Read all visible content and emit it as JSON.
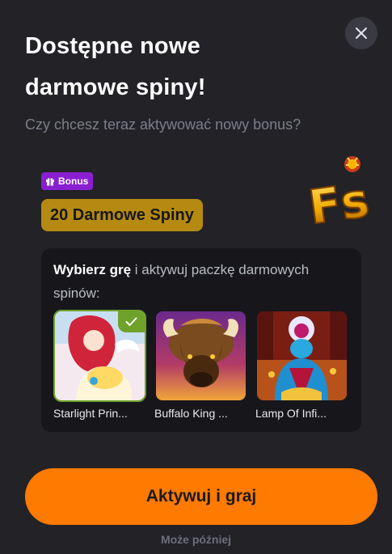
{
  "modal": {
    "title": "Dostępne nowe darmowe spiny!",
    "subtitle": "Czy chcesz teraz aktywować nowy bonus?",
    "close_icon": "close-icon"
  },
  "bonus": {
    "badge_label": "Bonus",
    "badge_icon": "gift-icon",
    "offer_label": "20 Darmowe Spiny",
    "logo_text": "Fs",
    "colors": {
      "badge": "#8a1fd1",
      "offer": "#b58a10"
    }
  },
  "game_picker": {
    "prompt_bold": "Wybierz grę",
    "prompt_rest": " i aktywuj paczkę darmowych spinów:",
    "games": [
      {
        "name": "Starlight Prin...",
        "selected": true
      },
      {
        "name": "Buffalo King ...",
        "selected": false
      },
      {
        "name": "Lamp Of Infi...",
        "selected": false
      }
    ],
    "selected_color": "#6fa22a"
  },
  "actions": {
    "primary_label": "Aktywuj i graj",
    "secondary_label": "Może później",
    "primary_color": "#ff7a00"
  }
}
